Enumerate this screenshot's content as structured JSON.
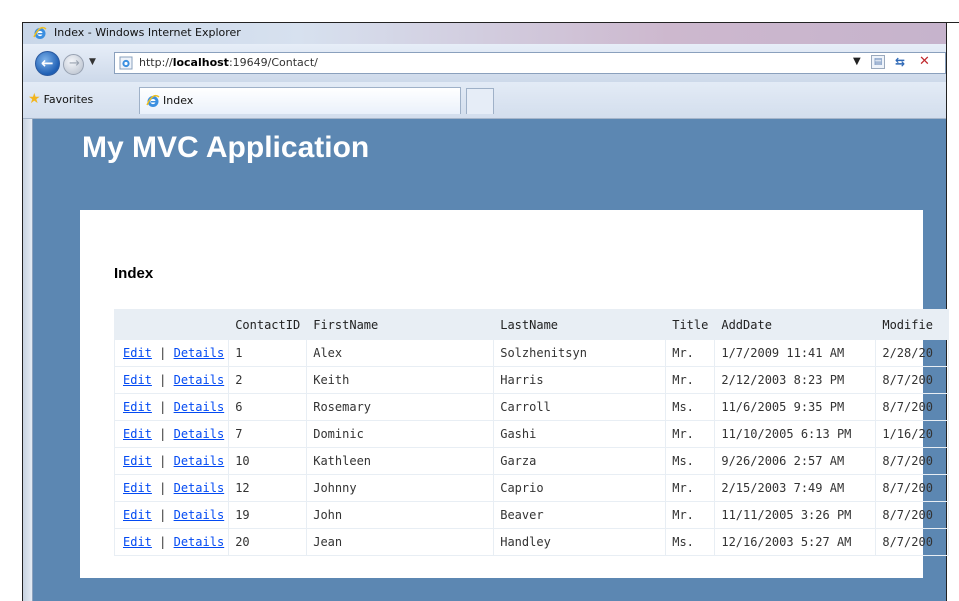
{
  "window": {
    "title": "Index - Windows Internet Explorer"
  },
  "address_bar": {
    "url_prefix": "http://",
    "url_host": "localhost",
    "url_rest": ":19649/Contact/"
  },
  "favorites_label": "Favorites",
  "tab": {
    "label": "Index"
  },
  "app": {
    "title": "My MVC Application"
  },
  "page": {
    "heading": "Index",
    "columns": [
      "",
      "ContactID",
      "FirstName",
      "LastName",
      "Title",
      "AddDate",
      "Modifie"
    ],
    "edit_label": "Edit",
    "details_label": "Details",
    "separator": "|",
    "rows": [
      {
        "id": "1",
        "first": "Alex",
        "last": "Solzhenitsyn",
        "title": "Mr.",
        "add": "1/7/2009 11:41 AM",
        "mod": "2/28/20"
      },
      {
        "id": "2",
        "first": "Keith",
        "last": "Harris",
        "title": "Mr.",
        "add": "2/12/2003 8:23 PM",
        "mod": "8/7/200"
      },
      {
        "id": "6",
        "first": "Rosemary",
        "last": "Carroll",
        "title": "Ms.",
        "add": "11/6/2005 9:35 PM",
        "mod": "8/7/200"
      },
      {
        "id": "7",
        "first": "Dominic",
        "last": "Gashi",
        "title": "Mr.",
        "add": "11/10/2005 6:13 PM",
        "mod": "1/16/20"
      },
      {
        "id": "10",
        "first": "Kathleen",
        "last": "Garza",
        "title": "Ms.",
        "add": "9/26/2006 2:57 AM",
        "mod": "8/7/200"
      },
      {
        "id": "12",
        "first": "Johnny",
        "last": "Caprio",
        "title": "Mr.",
        "add": "2/15/2003 7:49 AM",
        "mod": "8/7/200"
      },
      {
        "id": "19",
        "first": "John",
        "last": "Beaver",
        "title": "Mr.",
        "add": "11/11/2005 3:26 PM",
        "mod": "8/7/200"
      },
      {
        "id": "20",
        "first": "Jean",
        "last": "Handley",
        "title": "Ms.",
        "add": "12/16/2003 5:27 AM",
        "mod": "8/7/200"
      }
    ]
  },
  "icons": {
    "ie_logo": "internet-explorer-icon",
    "back": "back-arrow-icon",
    "forward": "forward-arrow-icon",
    "rss": "rss-feed-icon",
    "refresh": "refresh-icon",
    "stop": "stop-icon",
    "star": "favorites-star-icon"
  },
  "colors": {
    "page_bg": "#5c87b2",
    "link": "#034af3",
    "header_row": "#e8eef4",
    "stop": "#c0282d"
  }
}
